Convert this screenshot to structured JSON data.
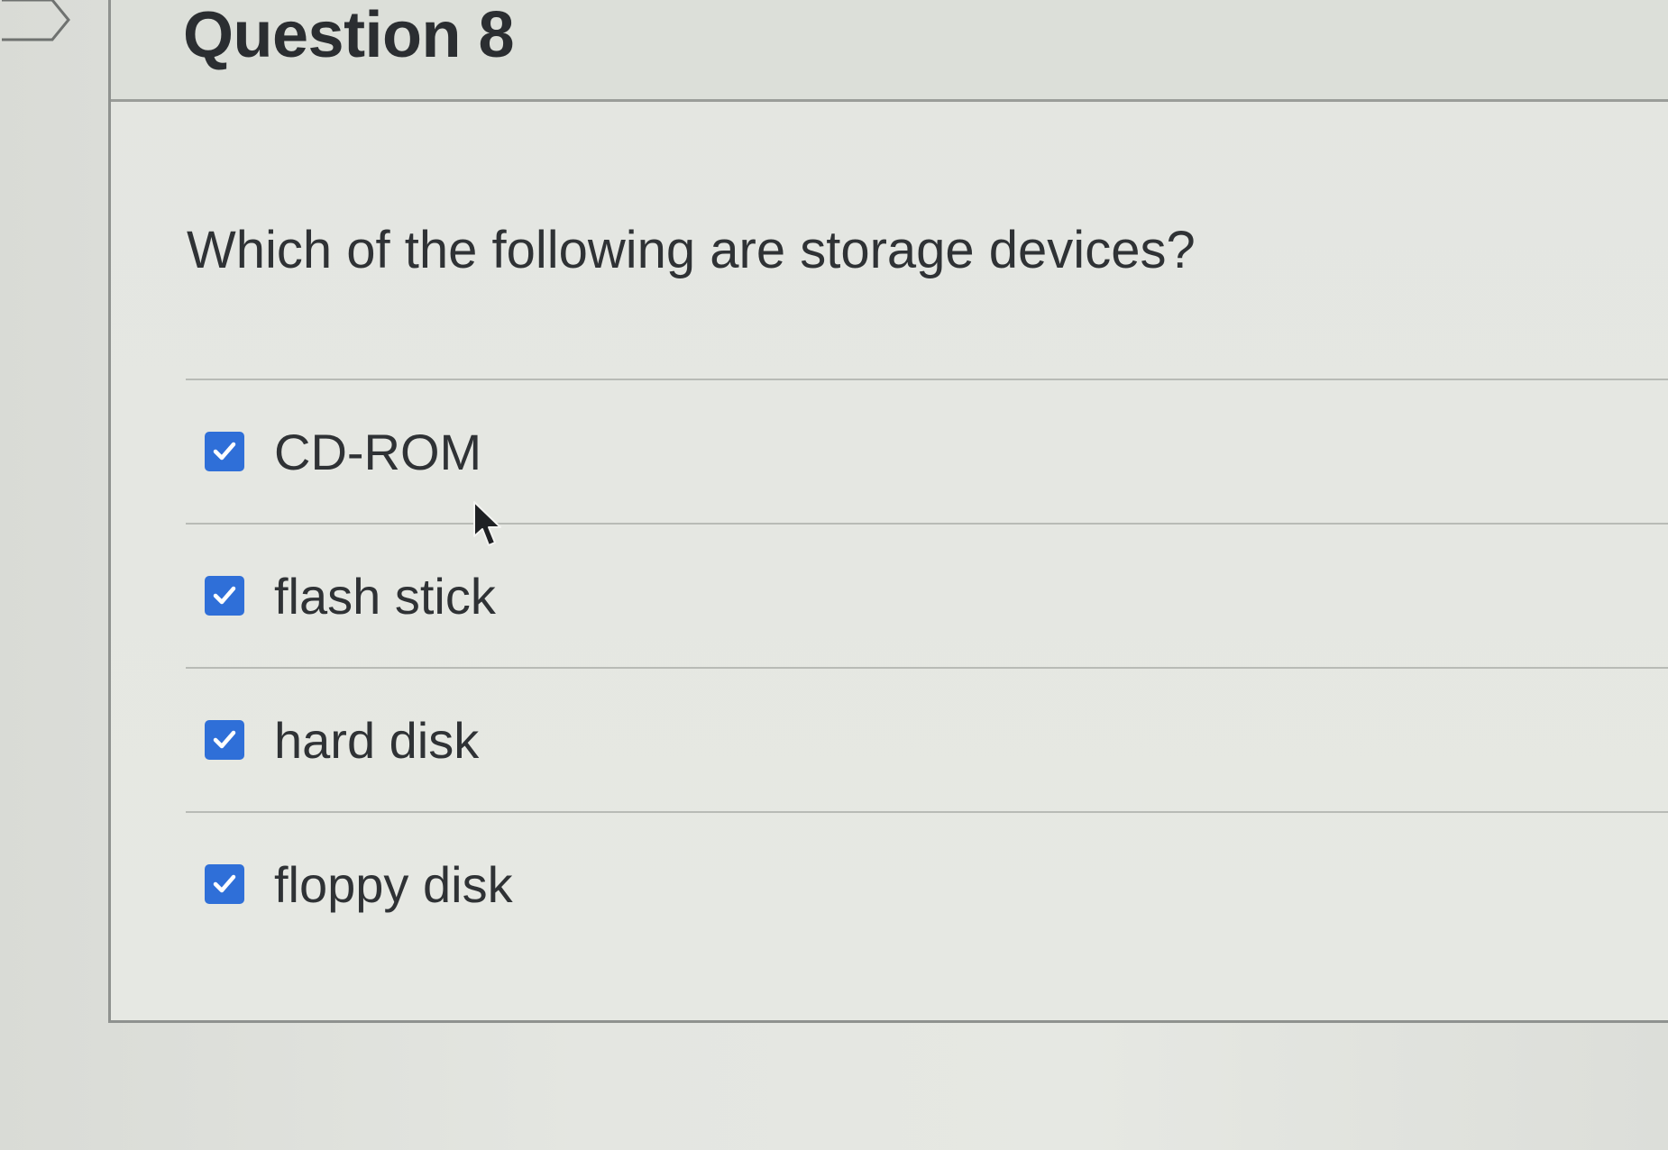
{
  "question": {
    "title": "Question 8",
    "prompt": "Which of the following are storage devices?"
  },
  "answers": [
    {
      "label": "CD-ROM",
      "checked": true
    },
    {
      "label": "flash stick",
      "checked": true
    },
    {
      "label": "hard disk",
      "checked": true
    },
    {
      "label": "floppy disk",
      "checked": true
    }
  ],
  "colors": {
    "checkbox_accent": "#2f6fd8",
    "text": "#2f3235",
    "background": "#e4e6e1"
  },
  "icons": {
    "flag": "flag-outline-icon",
    "checkbox": "checkmark-icon",
    "cursor": "mouse-pointer-icon"
  }
}
